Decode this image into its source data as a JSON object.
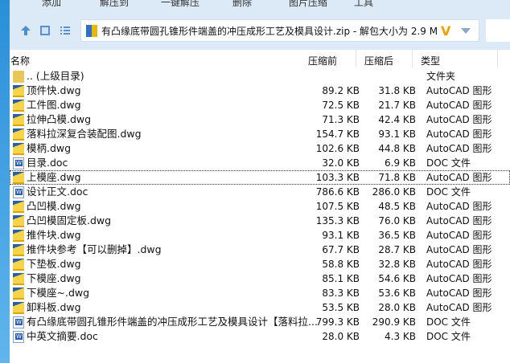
{
  "toolbar": {
    "items": [
      "添加",
      "解压到",
      "一键解压",
      "删除",
      "图片压缩",
      "工具"
    ]
  },
  "address": {
    "text": "有凸缘底带圆孔锥形件端盖的冲压成形工艺及模具设计.zip - 解包大小为 2.9 M"
  },
  "columns": {
    "name": "名称",
    "before": "压缩前",
    "after": "压缩后",
    "type": "类型"
  },
  "rows": [
    {
      "name": ".. (上级目录)",
      "before": "",
      "after": "",
      "type": "文件夹",
      "icon": "folder"
    },
    {
      "name": "顶件快.dwg",
      "before": "89.2 KB",
      "after": "31.8 KB",
      "type": "AutoCAD 图形",
      "icon": "dwg"
    },
    {
      "name": "工件图.dwg",
      "before": "72.5 KB",
      "after": "21.7 KB",
      "type": "AutoCAD 图形",
      "icon": "dwg"
    },
    {
      "name": "拉伸凸模.dwg",
      "before": "71.3 KB",
      "after": "42.4 KB",
      "type": "AutoCAD 图形",
      "icon": "dwg"
    },
    {
      "name": "落料拉深复合装配图.dwg",
      "before": "154.7 KB",
      "after": "93.1 KB",
      "type": "AutoCAD 图形",
      "icon": "dwg"
    },
    {
      "name": "模柄.dwg",
      "before": "102.6 KB",
      "after": "44.8 KB",
      "type": "AutoCAD 图形",
      "icon": "dwg"
    },
    {
      "name": "目录.doc",
      "before": "32.0 KB",
      "after": "6.9 KB",
      "type": "DOC 文件",
      "icon": "doc"
    },
    {
      "name": "上模座.dwg",
      "before": "103.3 KB",
      "after": "71.8 KB",
      "type": "AutoCAD 图形",
      "icon": "dwg"
    },
    {
      "name": "设计正文.doc",
      "before": "786.6 KB",
      "after": "286.0 KB",
      "type": "DOC 文件",
      "icon": "doc"
    },
    {
      "name": "凸凹模.dwg",
      "before": "107.5 KB",
      "after": "48.5 KB",
      "type": "AutoCAD 图形",
      "icon": "dwg"
    },
    {
      "name": "凸凹模固定板.dwg",
      "before": "135.3 KB",
      "after": "76.0 KB",
      "type": "AutoCAD 图形",
      "icon": "dwg"
    },
    {
      "name": "推件块.dwg",
      "before": "93.1 KB",
      "after": "36.5 KB",
      "type": "AutoCAD 图形",
      "icon": "dwg"
    },
    {
      "name": "推件块参考【可以删掉】.dwg",
      "before": "67.7 KB",
      "after": "28.7 KB",
      "type": "AutoCAD 图形",
      "icon": "dwg"
    },
    {
      "name": "下垫板.dwg",
      "before": "58.8 KB",
      "after": "32.8 KB",
      "type": "AutoCAD 图形",
      "icon": "dwg"
    },
    {
      "name": "下模座.dwg",
      "before": "85.1 KB",
      "after": "54.6 KB",
      "type": "AutoCAD 图形",
      "icon": "dwg"
    },
    {
      "name": "下模座~.dwg",
      "before": "83.3 KB",
      "after": "53.6 KB",
      "type": "AutoCAD 图形",
      "icon": "dwg"
    },
    {
      "name": "卸料板.dwg",
      "before": "53.5 KB",
      "after": "28.0 KB",
      "type": "AutoCAD 图形",
      "icon": "dwg"
    },
    {
      "name": "有凸缘底带圆孔锥形件端盖的冲压成形工艺及模具设计【落料拉...",
      "before": "799.3 KB",
      "after": "290.9 KB",
      "type": "DOC 文件",
      "icon": "doc"
    },
    {
      "name": "中英文摘要.doc",
      "before": "28.0 KB",
      "after": "4.3 KB",
      "type": "DOC 文件",
      "icon": "doc"
    }
  ]
}
